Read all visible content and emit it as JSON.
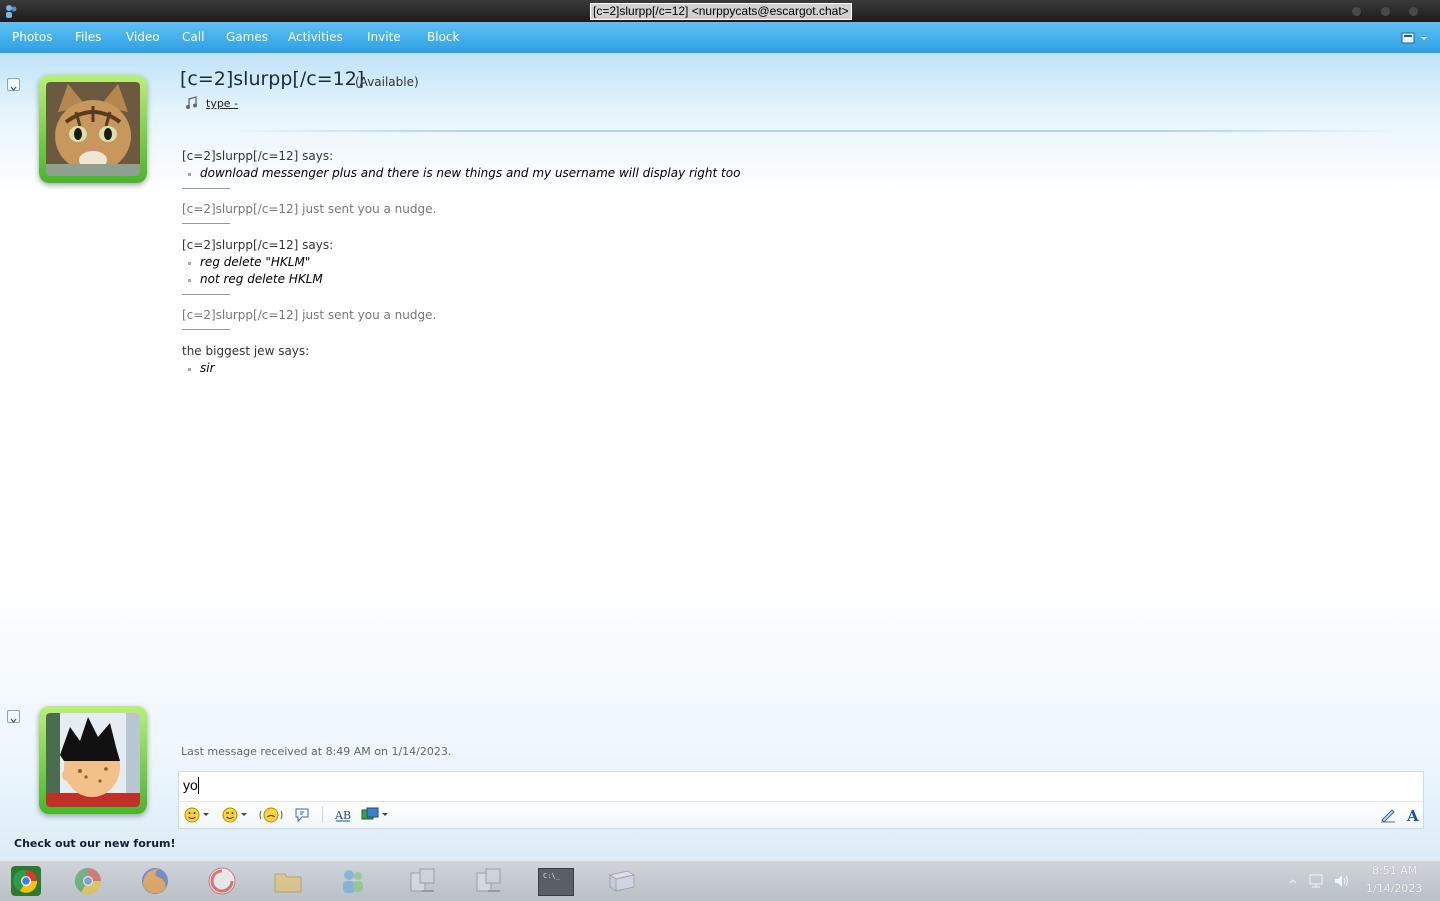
{
  "window": {
    "title": "[c=2]slurpp[/c=12] <nurppycats@escargot.chat>"
  },
  "menu": {
    "items": [
      "Photos",
      "Files",
      "Video",
      "Call",
      "Games",
      "Activities",
      "Invite",
      "Block"
    ]
  },
  "contact": {
    "name": "[c=2]slurpp[/c=12]",
    "status": "(Available)",
    "personal_message": "type -"
  },
  "conversation": {
    "blocks": [
      {
        "sender": "[c=2]slurpp[/c=12] says:",
        "lines": [
          "download messenger plus and there is new things and my username will display right too"
        ]
      },
      {
        "nudge": "[c=2]slurpp[/c=12] just sent you a nudge."
      },
      {
        "sender": "[c=2]slurpp[/c=12] says:",
        "lines": [
          "reg delete \"HKLM\"",
          "not reg delete HKLM"
        ]
      },
      {
        "nudge": "[c=2]slurpp[/c=12] just sent you a nudge."
      },
      {
        "sender": "the biggest jew says:",
        "lines": [
          "sir"
        ]
      }
    ]
  },
  "last_received": "Last message received at 8:49 AM on 1/14/2023.",
  "input": {
    "value": "yo"
  },
  "footer": {
    "forum_link": "Check out our new forum!"
  },
  "taskbar": {
    "apps": [
      "start-orb-icon",
      "chrome-icon",
      "firefox-icon",
      "dreamcast-icon",
      "folder-icon",
      "messenger-icon",
      "network-icon",
      "network-icon",
      "terminal-icon",
      "window-icon"
    ],
    "terminal_label": "C:\\_",
    "time": "8:51 AM",
    "date": "1/14/2023"
  },
  "colors": {
    "menubar": "#2f9fe3",
    "avatar_frame": "#48b52a"
  }
}
